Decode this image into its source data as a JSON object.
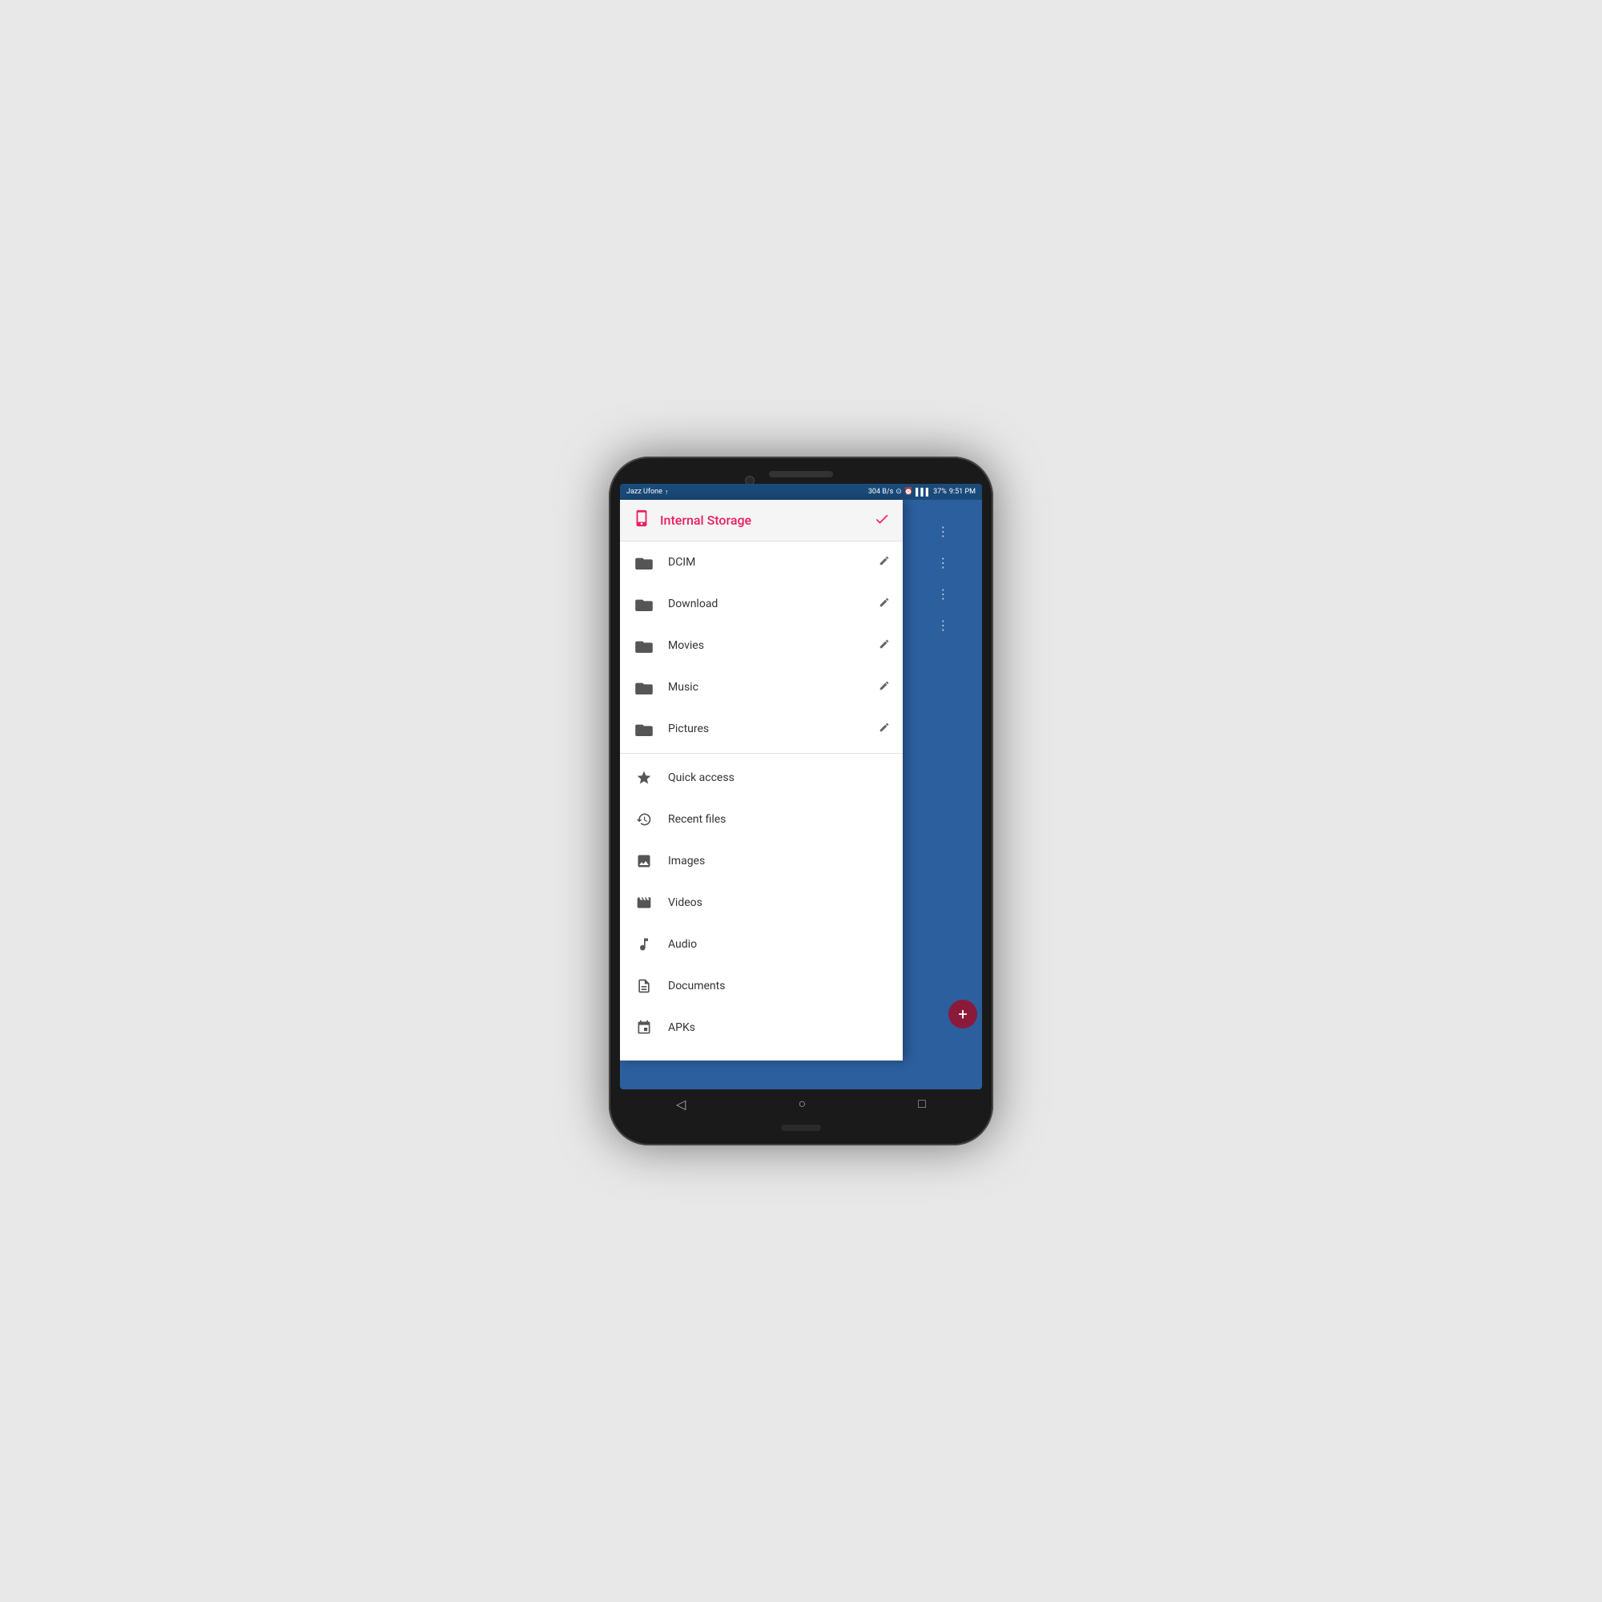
{
  "phone": {
    "status_bar": {
      "carrier": "Jazz Ufone",
      "speed": "304 B/s",
      "time": "9:51 PM",
      "battery": "37%"
    },
    "nav": {
      "back": "◁",
      "home": "○",
      "recent": "□"
    }
  },
  "drawer": {
    "header": {
      "title": "Internal Storage",
      "icon": "storage",
      "action_icon": "checkmark"
    },
    "folders": [
      {
        "name": "DCIM",
        "icon": "folder"
      },
      {
        "name": "Download",
        "icon": "folder"
      },
      {
        "name": "Movies",
        "icon": "folder"
      },
      {
        "name": "Music",
        "icon": "folder"
      },
      {
        "name": "Pictures",
        "icon": "folder"
      }
    ],
    "quick_items": [
      {
        "name": "Quick access",
        "icon": "star"
      },
      {
        "name": "Recent files",
        "icon": "clock"
      },
      {
        "name": "Images",
        "icon": "image"
      },
      {
        "name": "Videos",
        "icon": "video"
      },
      {
        "name": "Audio",
        "icon": "audio"
      },
      {
        "name": "Documents",
        "icon": "doc"
      },
      {
        "name": "APKs",
        "icon": "apk"
      }
    ]
  }
}
